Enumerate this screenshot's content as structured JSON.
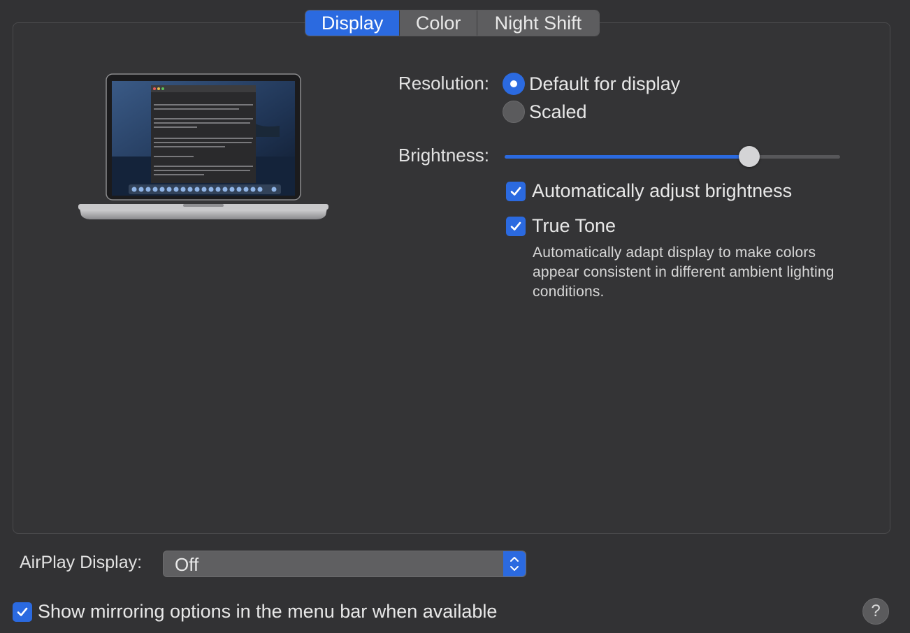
{
  "tabs": [
    {
      "label": "Display",
      "active": true
    },
    {
      "label": "Color",
      "active": false
    },
    {
      "label": "Night Shift",
      "active": false
    }
  ],
  "resolution": {
    "label": "Resolution:",
    "options": [
      {
        "label": "Default for display",
        "selected": true
      },
      {
        "label": "Scaled",
        "selected": false
      }
    ]
  },
  "brightness": {
    "label": "Brightness:",
    "value_fraction": 0.73
  },
  "checkboxes": {
    "auto_brightness": {
      "label": "Automatically adjust brightness",
      "checked": true
    },
    "true_tone": {
      "label": "True Tone",
      "checked": true
    }
  },
  "true_tone_description": "Automatically adapt display to make colors appear consistent in different ambient lighting conditions.",
  "airplay": {
    "label": "AirPlay Display:",
    "value": "Off"
  },
  "mirroring": {
    "label": "Show mirroring options in the menu bar when available",
    "checked": true
  },
  "help_label": "?",
  "icons": {
    "laptop": "macbook-pro-illustration",
    "checkmark": "checkmark-icon",
    "updown": "chevron-updown-icon",
    "help": "help-icon"
  },
  "colors": {
    "accent": "#2b6ae0",
    "background": "#323234"
  }
}
